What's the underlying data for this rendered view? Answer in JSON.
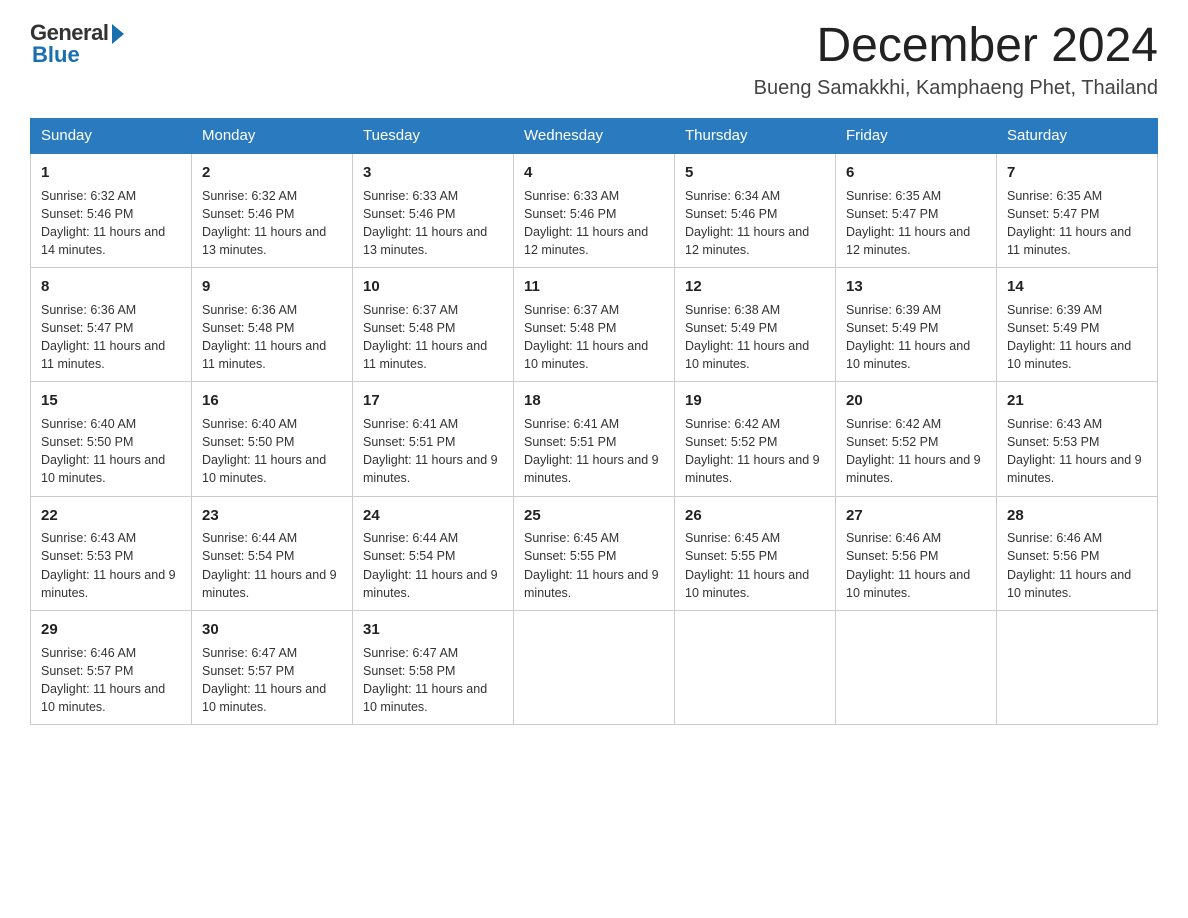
{
  "logo": {
    "general": "General",
    "blue": "Blue"
  },
  "header": {
    "month": "December 2024",
    "location": "Bueng Samakkhi, Kamphaeng Phet, Thailand"
  },
  "days": [
    "Sunday",
    "Monday",
    "Tuesday",
    "Wednesday",
    "Thursday",
    "Friday",
    "Saturday"
  ],
  "weeks": [
    [
      {
        "num": "1",
        "sunrise": "6:32 AM",
        "sunset": "5:46 PM",
        "daylight": "11 hours and 14 minutes."
      },
      {
        "num": "2",
        "sunrise": "6:32 AM",
        "sunset": "5:46 PM",
        "daylight": "11 hours and 13 minutes."
      },
      {
        "num": "3",
        "sunrise": "6:33 AM",
        "sunset": "5:46 PM",
        "daylight": "11 hours and 13 minutes."
      },
      {
        "num": "4",
        "sunrise": "6:33 AM",
        "sunset": "5:46 PM",
        "daylight": "11 hours and 12 minutes."
      },
      {
        "num": "5",
        "sunrise": "6:34 AM",
        "sunset": "5:46 PM",
        "daylight": "11 hours and 12 minutes."
      },
      {
        "num": "6",
        "sunrise": "6:35 AM",
        "sunset": "5:47 PM",
        "daylight": "11 hours and 12 minutes."
      },
      {
        "num": "7",
        "sunrise": "6:35 AM",
        "sunset": "5:47 PM",
        "daylight": "11 hours and 11 minutes."
      }
    ],
    [
      {
        "num": "8",
        "sunrise": "6:36 AM",
        "sunset": "5:47 PM",
        "daylight": "11 hours and 11 minutes."
      },
      {
        "num": "9",
        "sunrise": "6:36 AM",
        "sunset": "5:48 PM",
        "daylight": "11 hours and 11 minutes."
      },
      {
        "num": "10",
        "sunrise": "6:37 AM",
        "sunset": "5:48 PM",
        "daylight": "11 hours and 11 minutes."
      },
      {
        "num": "11",
        "sunrise": "6:37 AM",
        "sunset": "5:48 PM",
        "daylight": "11 hours and 10 minutes."
      },
      {
        "num": "12",
        "sunrise": "6:38 AM",
        "sunset": "5:49 PM",
        "daylight": "11 hours and 10 minutes."
      },
      {
        "num": "13",
        "sunrise": "6:39 AM",
        "sunset": "5:49 PM",
        "daylight": "11 hours and 10 minutes."
      },
      {
        "num": "14",
        "sunrise": "6:39 AM",
        "sunset": "5:49 PM",
        "daylight": "11 hours and 10 minutes."
      }
    ],
    [
      {
        "num": "15",
        "sunrise": "6:40 AM",
        "sunset": "5:50 PM",
        "daylight": "11 hours and 10 minutes."
      },
      {
        "num": "16",
        "sunrise": "6:40 AM",
        "sunset": "5:50 PM",
        "daylight": "11 hours and 10 minutes."
      },
      {
        "num": "17",
        "sunrise": "6:41 AM",
        "sunset": "5:51 PM",
        "daylight": "11 hours and 9 minutes."
      },
      {
        "num": "18",
        "sunrise": "6:41 AM",
        "sunset": "5:51 PM",
        "daylight": "11 hours and 9 minutes."
      },
      {
        "num": "19",
        "sunrise": "6:42 AM",
        "sunset": "5:52 PM",
        "daylight": "11 hours and 9 minutes."
      },
      {
        "num": "20",
        "sunrise": "6:42 AM",
        "sunset": "5:52 PM",
        "daylight": "11 hours and 9 minutes."
      },
      {
        "num": "21",
        "sunrise": "6:43 AM",
        "sunset": "5:53 PM",
        "daylight": "11 hours and 9 minutes."
      }
    ],
    [
      {
        "num": "22",
        "sunrise": "6:43 AM",
        "sunset": "5:53 PM",
        "daylight": "11 hours and 9 minutes."
      },
      {
        "num": "23",
        "sunrise": "6:44 AM",
        "sunset": "5:54 PM",
        "daylight": "11 hours and 9 minutes."
      },
      {
        "num": "24",
        "sunrise": "6:44 AM",
        "sunset": "5:54 PM",
        "daylight": "11 hours and 9 minutes."
      },
      {
        "num": "25",
        "sunrise": "6:45 AM",
        "sunset": "5:55 PM",
        "daylight": "11 hours and 9 minutes."
      },
      {
        "num": "26",
        "sunrise": "6:45 AM",
        "sunset": "5:55 PM",
        "daylight": "11 hours and 10 minutes."
      },
      {
        "num": "27",
        "sunrise": "6:46 AM",
        "sunset": "5:56 PM",
        "daylight": "11 hours and 10 minutes."
      },
      {
        "num": "28",
        "sunrise": "6:46 AM",
        "sunset": "5:56 PM",
        "daylight": "11 hours and 10 minutes."
      }
    ],
    [
      {
        "num": "29",
        "sunrise": "6:46 AM",
        "sunset": "5:57 PM",
        "daylight": "11 hours and 10 minutes."
      },
      {
        "num": "30",
        "sunrise": "6:47 AM",
        "sunset": "5:57 PM",
        "daylight": "11 hours and 10 minutes."
      },
      {
        "num": "31",
        "sunrise": "6:47 AM",
        "sunset": "5:58 PM",
        "daylight": "11 hours and 10 minutes."
      },
      null,
      null,
      null,
      null
    ]
  ],
  "labels": {
    "sunrise": "Sunrise:",
    "sunset": "Sunset:",
    "daylight": "Daylight:"
  }
}
